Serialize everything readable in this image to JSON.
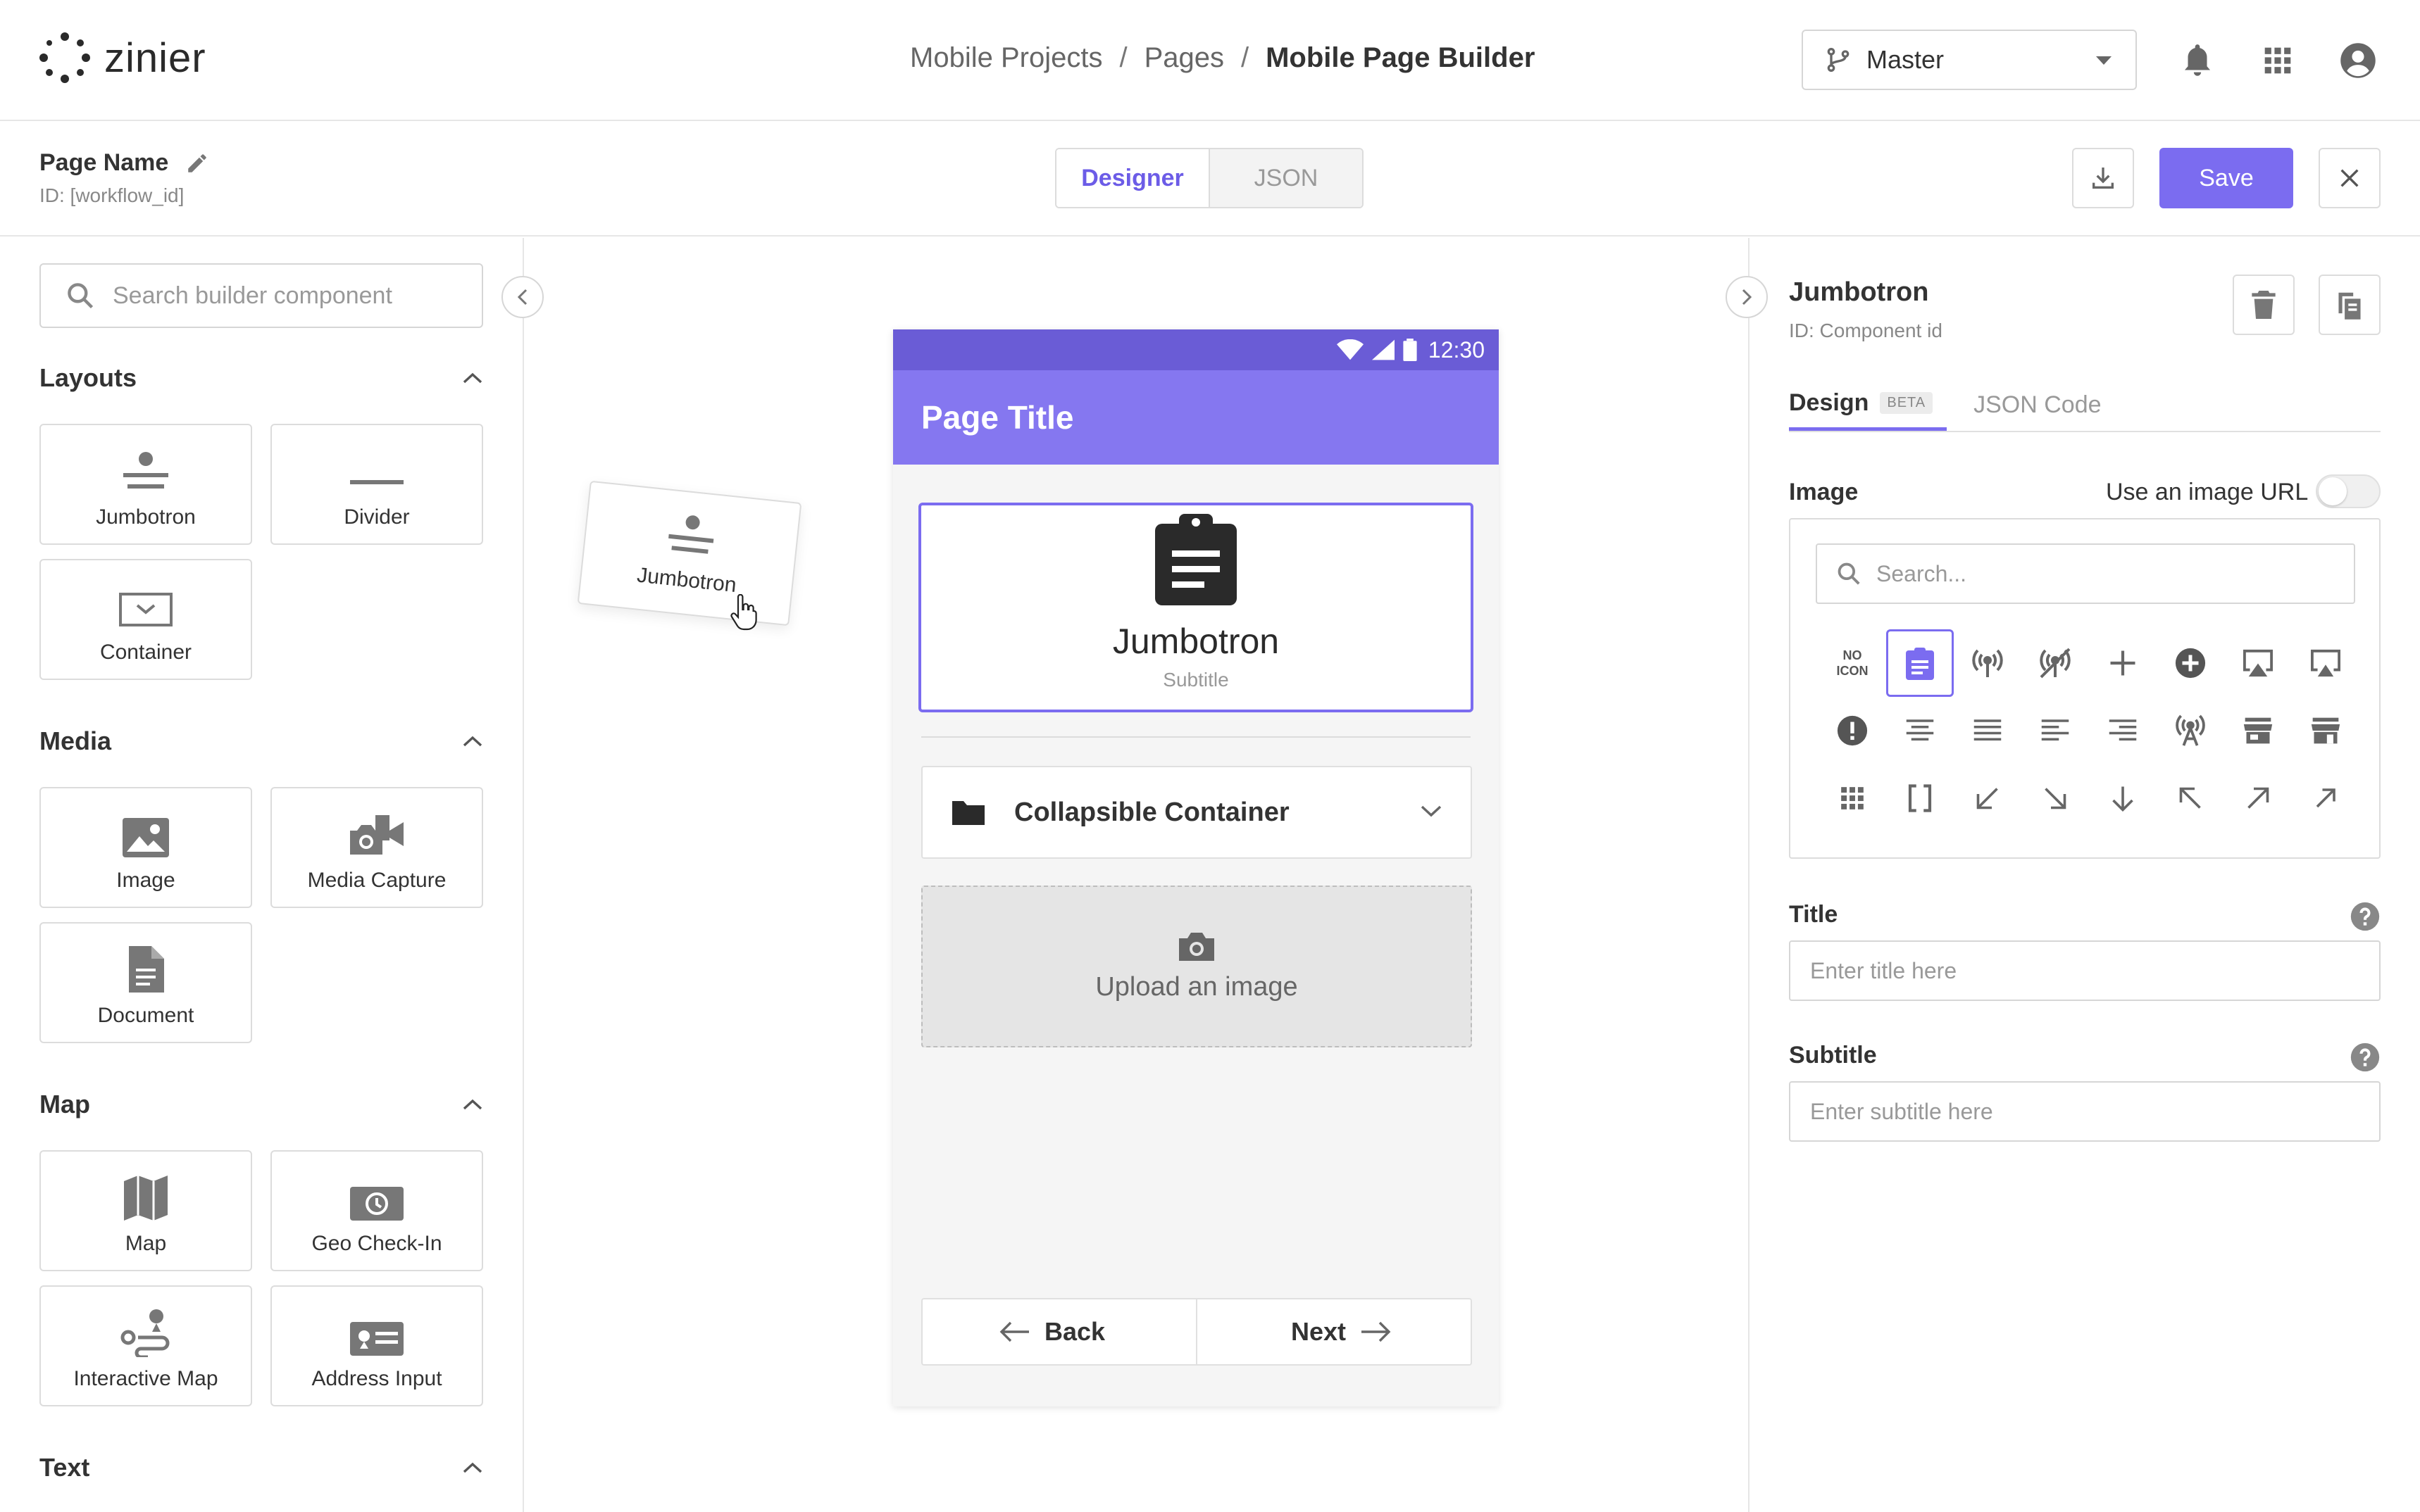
{
  "app": {
    "logo_text": "zinier",
    "breadcrumb": [
      "Mobile Projects",
      "Pages",
      "Mobile Page Builder"
    ],
    "breadcrumb_separator": "/",
    "branch": "Master"
  },
  "page": {
    "name": "Page Name",
    "id": "ID: [workflow_id]",
    "mode_tabs": [
      "Designer",
      "JSON"
    ],
    "active_mode": "Designer",
    "save_label": "Save"
  },
  "left_panel": {
    "search_placeholder": "Search builder component",
    "sections": [
      {
        "title": "Layouts",
        "items": [
          "Jumbotron",
          "Divider",
          "Container"
        ]
      },
      {
        "title": "Media",
        "items": [
          "Image",
          "Media Capture",
          "Document"
        ]
      },
      {
        "title": "Map",
        "items": [
          "Map",
          "Geo Check-In",
          "Interactive Map",
          "Address Input"
        ]
      },
      {
        "title": "Text",
        "items": []
      }
    ]
  },
  "canvas": {
    "dragging_item": "Jumbotron",
    "phone": {
      "time": "12:30",
      "page_title": "Page Title",
      "jumbotron_title": "Jumbotron",
      "jumbotron_subtitle": "Subtitle",
      "collapsible_label": "Collapsible Container",
      "upload_label": "Upload an image",
      "back_label": "Back",
      "next_label": "Next"
    }
  },
  "right_panel": {
    "title": "Jumbotron",
    "id": "ID: Component id",
    "tabs": [
      "Design",
      "JSON Code"
    ],
    "beta_badge": "BETA",
    "image_label": "Image",
    "use_url_label": "Use an image URL",
    "use_url_enabled": false,
    "icon_search_placeholder": "Search...",
    "no_icon_label": [
      "NO",
      "ICON"
    ],
    "selected_icon": "clipboard-icon",
    "icons": [
      "no-icon",
      "clipboard-icon",
      "broadcast-icon",
      "broadcast-off-icon",
      "plus-icon",
      "add-circle-icon",
      "airplay-icon",
      "airplay-alt-icon",
      "alert-circle-icon",
      "align-center-icon",
      "align-justify-icon",
      "align-left-icon",
      "align-right-icon",
      "antenna-icon",
      "storefront-icon",
      "storefront-alt-icon",
      "apps-grid-icon",
      "brackets-icon",
      "arrow-down-left-icon",
      "arrow-down-right-icon",
      "arrow-down-icon",
      "arrow-up-left-icon",
      "arrow-up-right-icon",
      "arrow-up-right-alt-icon"
    ],
    "title_label": "Title",
    "title_placeholder": "Enter title here",
    "subtitle_label": "Subtitle",
    "subtitle_placeholder": "Enter subtitle here"
  },
  "colors": {
    "accent": "#7b6cf0",
    "status_bar": "#6a5cd6",
    "app_bar": "#8577f0"
  }
}
